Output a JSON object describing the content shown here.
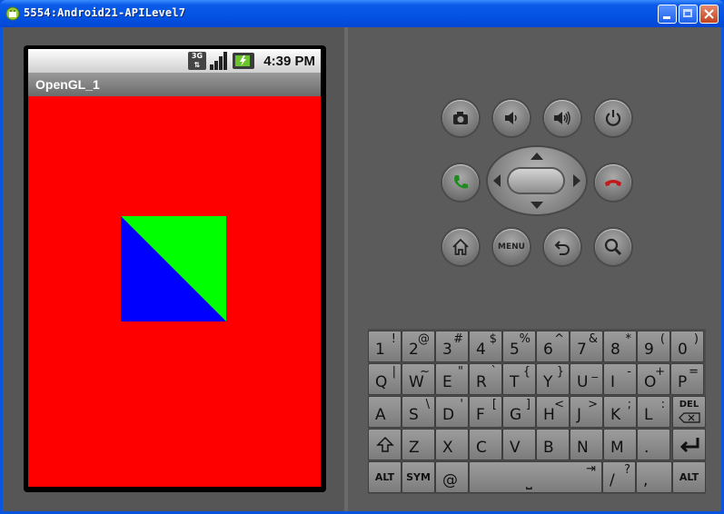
{
  "window": {
    "title": "5554:Android21-APILevel7"
  },
  "statusbar": {
    "network": "3G",
    "time": "4:39 PM"
  },
  "app": {
    "title": "OpenGL_1"
  },
  "colors": {
    "gl_background": "#ff0000",
    "triangle_a": "#00ff00",
    "triangle_b": "#0000ff"
  },
  "controls": {
    "top_row": [
      "camera-icon",
      "volume-down-icon",
      "volume-up-icon",
      "power-icon"
    ],
    "call": "call-icon",
    "end_call": "end-call-icon",
    "bottom_row": [
      "home-icon",
      "menu-button",
      "back-icon",
      "search-icon"
    ],
    "menu_label": "MENU"
  },
  "keyboard": {
    "row1": [
      {
        "main": "1",
        "alt": "!"
      },
      {
        "main": "2",
        "alt": "@"
      },
      {
        "main": "3",
        "alt": "#"
      },
      {
        "main": "4",
        "alt": "$"
      },
      {
        "main": "5",
        "alt": "%"
      },
      {
        "main": "6",
        "alt": "^"
      },
      {
        "main": "7",
        "alt": "&"
      },
      {
        "main": "8",
        "alt": "*"
      },
      {
        "main": "9",
        "alt": "("
      },
      {
        "main": "0",
        "alt": ")"
      }
    ],
    "row2": [
      {
        "main": "Q",
        "alt": "|"
      },
      {
        "main": "W",
        "alt": "~"
      },
      {
        "main": "E",
        "alt": "\""
      },
      {
        "main": "R",
        "alt": "`"
      },
      {
        "main": "T",
        "alt": "{"
      },
      {
        "main": "Y",
        "alt": "}"
      },
      {
        "main": "U",
        "alt": "_"
      },
      {
        "main": "I",
        "alt": "-"
      },
      {
        "main": "O",
        "alt": "+"
      },
      {
        "main": "P",
        "alt": "="
      }
    ],
    "row3": [
      {
        "main": "A",
        "alt": ""
      },
      {
        "main": "S",
        "alt": "\\"
      },
      {
        "main": "D",
        "alt": "'"
      },
      {
        "main": "F",
        "alt": "["
      },
      {
        "main": "G",
        "alt": "]"
      },
      {
        "main": "H",
        "alt": "<"
      },
      {
        "main": "J",
        "alt": ">"
      },
      {
        "main": "K",
        "alt": ";"
      },
      {
        "main": "L",
        "alt": ":"
      }
    ],
    "del_label": "DEL",
    "row4": [
      {
        "main": "Z",
        "alt": ""
      },
      {
        "main": "X",
        "alt": ""
      },
      {
        "main": "C",
        "alt": ""
      },
      {
        "main": "V",
        "alt": ""
      },
      {
        "main": "B",
        "alt": ""
      },
      {
        "main": "N",
        "alt": ""
      },
      {
        "main": "M",
        "alt": ""
      },
      {
        "main": ".",
        "alt": ""
      }
    ],
    "alt_label": "ALT",
    "sym_label": "SYM",
    "at_label": "@",
    "space_symbol": "⎵",
    "tab_symbol": "⇥",
    "slash_label": "/",
    "question_label": "?",
    "comma_label": ","
  }
}
